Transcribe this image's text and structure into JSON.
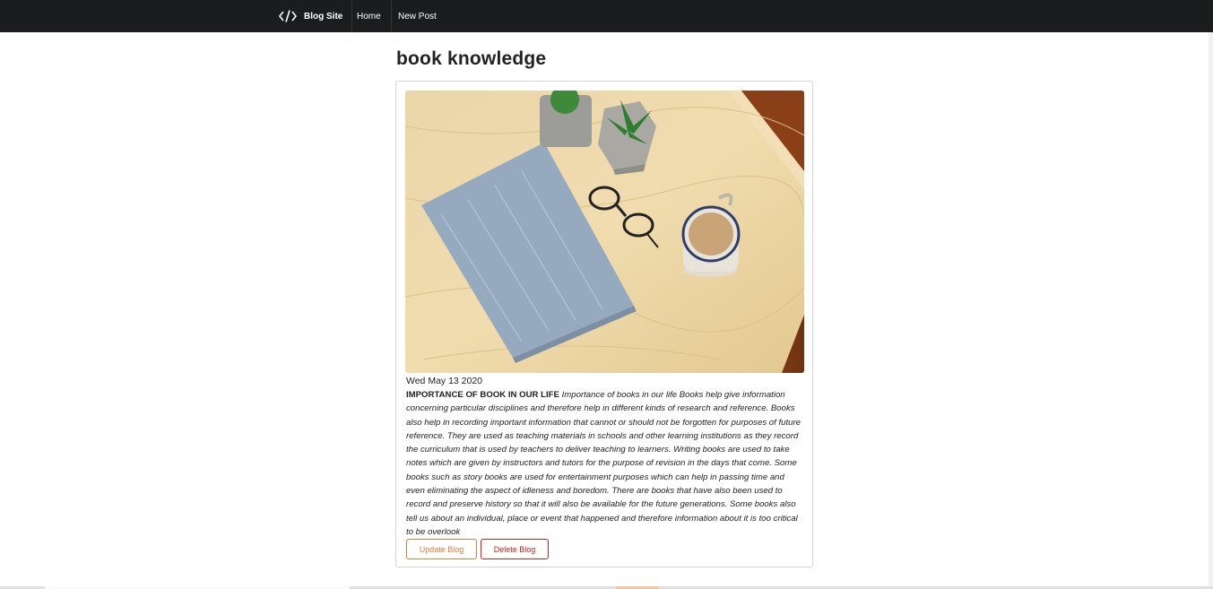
{
  "nav": {
    "brand": "Blog Site",
    "items": [
      {
        "label": "Home"
      },
      {
        "label": "New Post"
      }
    ]
  },
  "page": {
    "title": "book knowledge"
  },
  "post": {
    "date": "Wed May 13 2020",
    "heading": "IMPORTANCE OF BOOK IN OUR LIFE",
    "body": "Importance of books in our life Books help give information concerning particular disciplines and therefore help in different kinds of research and reference. Books also help in recording important information that cannot or should not be forgotten for purposes of future reference. They are used as teaching materials in schools and other learning institutions as they record the curriculum that is used by teachers to deliver teaching to learners. Writing books are used to take notes which are given by instructors and tutors for the purpose of revision in the days that come. Some books such as story books are used for entertainment purposes which can help in passing time and even eliminating the aspect of idleness and boredom. There are books that have also been used to record and preserve history so that it will also be available for the future generations. Some books also tell us about an individual, place or event that happened and therefore information about it is too critical to be overlook",
    "image_icon": "book-desk-photo",
    "actions": {
      "update_label": "Update Blog",
      "delete_label": "Delete Blog"
    }
  },
  "colors": {
    "navbar": "#1b1c1d",
    "update_accent": "#e07b39",
    "delete_accent": "#cc2020"
  }
}
